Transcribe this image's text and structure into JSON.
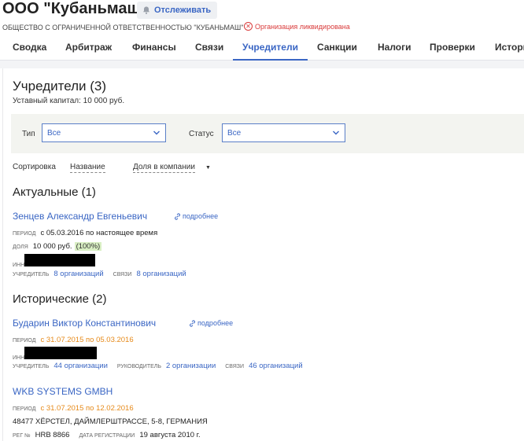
{
  "header": {
    "company_title": "ООО \"Кубаньмаш\"",
    "follow_label": "Отслеживать",
    "full_name": "ОБЩЕСТВО С ОГРАНИЧЕННОЙ ОТВЕТСТВЕННОСТЬЮ \"КУБАНЬМАШ\"",
    "status": "Организация ликвидирована"
  },
  "tabs": [
    "Сводка",
    "Арбитраж",
    "Финансы",
    "Связи",
    "Учредители",
    "Санкции",
    "Налоги",
    "Проверки",
    "История"
  ],
  "active_tab": "Учредители",
  "founders": {
    "title": "Учредители (3)",
    "capital": "Уставный капитал: 10 000 руб.",
    "filters": {
      "type_label": "Тип",
      "type_value": "Все",
      "status_label": "Статус",
      "status_value": "Все"
    },
    "sort": {
      "label": "Сортировка",
      "by_name": "Название",
      "by_share": "Доля в компании"
    },
    "current_section": "Актуальные (1)",
    "historical_section": "Исторические (2)",
    "labels": {
      "period": "период",
      "share": "доля",
      "inn": "ИНН",
      "founder": "учредитель",
      "links": "связи",
      "director": "руководитель",
      "reg_no": "рег №",
      "reg_date": "дата регистрации",
      "more": "подробнее"
    },
    "current": [
      {
        "name": "Зенцев Александр Евгеньевич",
        "period": "с 05.03.2016 по настоящее время",
        "share_amount": "10 000 руб.",
        "share_percent": "(100%)",
        "founder_orgs": "8 организаций",
        "link_orgs": "8 организаций"
      }
    ],
    "historical": [
      {
        "name": "Бударин Виктор Константинович",
        "period": "с 31.07.2015 по 05.03.2016",
        "founder_orgs": "44 организации",
        "director_orgs": "2 организации",
        "link_orgs": "46 организаций"
      },
      {
        "name": "WKB SYSTEMS GMBH",
        "period": "с 31.07.2015 по 12.02.2016",
        "address": "48477 ХЁРСТЕЛ, ДАЙМЛЕРШТРАССЕ, 5-8, ГЕРМАНИЯ",
        "reg_no": "HRB 8866",
        "reg_date": "19 августа 2010 г."
      }
    ]
  },
  "colors": {
    "accent": "#3a66c4",
    "danger": "#d93a3a",
    "historical_period": "#e68a1a",
    "share_highlight": "#d9efc4",
    "filter_bg": "#f3f4f0"
  }
}
